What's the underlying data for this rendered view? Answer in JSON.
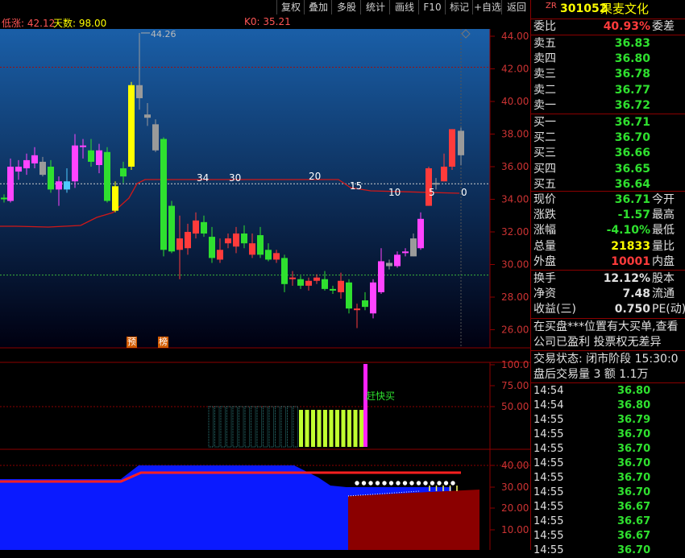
{
  "toolbar": {
    "buttons": [
      "复权",
      "叠加",
      "多股",
      "统计",
      "画线",
      "F10",
      "标记",
      "+自选",
      "返回"
    ]
  },
  "main_info": {
    "item1": "低涨: 42.12",
    "item2": "天数: 98.00",
    "item3": "K0: 35.21"
  },
  "markers": {
    "yu": "预",
    "bang": "榜"
  },
  "price_axis": [
    "44.00",
    "42.00",
    "40.00",
    "38.00",
    "36.00",
    "34.00",
    "32.00",
    "30.00",
    "28.00",
    "26.00"
  ],
  "peak_label": "44.26",
  "curve_labels": [
    "34",
    "30",
    "20",
    "15",
    "10",
    "5",
    "0"
  ],
  "mid_axis": [
    "100.0",
    "75.00",
    "50.00"
  ],
  "mid_label": "赶快买",
  "bottom_axis": [
    "40.00",
    "30.00",
    "20.00",
    "10.00"
  ],
  "colors": {
    "up": "#ff3b3b",
    "down": "#2fe02f",
    "magenta": "#ff44ff",
    "yellow": "#ffff00",
    "panel_border": "#8b0000"
  },
  "panel": {
    "prefix": "ZR",
    "code": "301052",
    "name": "果麦文化",
    "weibi_label": "委比",
    "weibi_value": "40.93%",
    "weicha_label": "委差",
    "sell": [
      {
        "label": "卖五",
        "price": "36.83"
      },
      {
        "label": "卖四",
        "price": "36.80"
      },
      {
        "label": "卖三",
        "price": "36.78"
      },
      {
        "label": "卖二",
        "price": "36.77"
      },
      {
        "label": "卖一",
        "price": "36.72"
      }
    ],
    "buy": [
      {
        "label": "买一",
        "price": "36.71"
      },
      {
        "label": "买二",
        "price": "36.70"
      },
      {
        "label": "买三",
        "price": "36.66"
      },
      {
        "label": "买四",
        "price": "36.65"
      },
      {
        "label": "买五",
        "price": "36.64"
      }
    ],
    "quote": [
      {
        "label": "现价",
        "value": "36.71",
        "label2": "今开"
      },
      {
        "label": "涨跌",
        "value": "-1.57",
        "label2": "最高"
      },
      {
        "label": "涨幅",
        "value": "-4.10%",
        "label2": "最低"
      },
      {
        "label": "总量",
        "value": "21833",
        "label2": "量比"
      },
      {
        "label": "外盘",
        "value": "10001",
        "label2": "内盘"
      }
    ],
    "fund": [
      {
        "label": "换手",
        "value": "12.12%",
        "label2": "股本"
      },
      {
        "label": "净资",
        "value": "7.48",
        "label2": "流通"
      },
      {
        "label": "收益(三)",
        "value": "0.750",
        "label2": "PE(动)"
      }
    ],
    "notice1": "在买盘***位置有大买单,查看",
    "notice2": "公司已盈利 投票权无差异",
    "status": "交易状态: 闭市阶段 15:30:0",
    "after_hours": "盘后交易量 3 额 1.1万",
    "ticks": [
      {
        "time": "14:54",
        "price": "36.80"
      },
      {
        "time": "14:54",
        "price": "36.80"
      },
      {
        "time": "14:55",
        "price": "36.79"
      },
      {
        "time": "14:55",
        "price": "36.70"
      },
      {
        "time": "14:55",
        "price": "36.70"
      },
      {
        "time": "14:55",
        "price": "36.70"
      },
      {
        "time": "14:55",
        "price": "36.70"
      },
      {
        "time": "14:55",
        "price": "36.70"
      },
      {
        "time": "14:55",
        "price": "36.67"
      },
      {
        "time": "14:55",
        "price": "36.67"
      },
      {
        "time": "14:55",
        "price": "36.67"
      },
      {
        "time": "14:55",
        "price": "36.70"
      }
    ]
  }
}
